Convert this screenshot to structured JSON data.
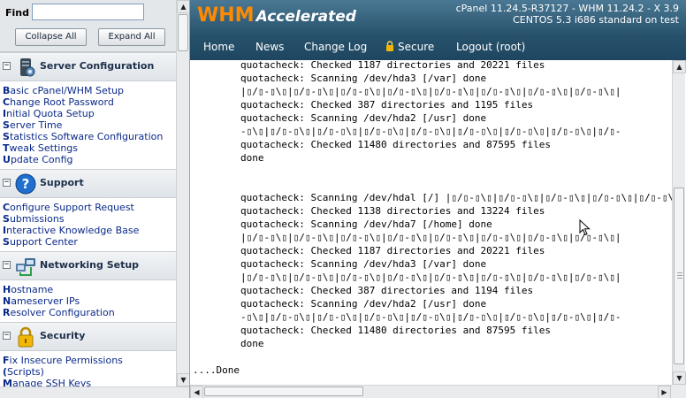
{
  "find": {
    "label": "Find",
    "value": "",
    "collapse_label": "Collapse All",
    "expand_label": "Expand All"
  },
  "sections": [
    {
      "title": "Server Configuration",
      "icon": "server-config-icon",
      "items": [
        {
          "first": "B",
          "rest": "asic cPanel/WHM Setup"
        },
        {
          "first": "C",
          "rest": "hange Root Password"
        },
        {
          "first": "I",
          "rest": "nitial Quota Setup"
        },
        {
          "first": "S",
          "rest": "erver Time"
        },
        {
          "first": "S",
          "rest": "tatistics Software Configuration"
        },
        {
          "first": "T",
          "rest": "weak Settings"
        },
        {
          "first": "U",
          "rest": "pdate Config"
        }
      ]
    },
    {
      "title": "Support",
      "icon": "support-icon",
      "items": [
        {
          "first": "C",
          "rest": "onfigure Support Request"
        },
        {
          "first": "S",
          "rest": "ubmissions"
        },
        {
          "first": "I",
          "rest": "nteractive Knowledge Base"
        },
        {
          "first": "S",
          "rest": "upport Center"
        }
      ]
    },
    {
      "title": "Networking Setup",
      "icon": "networking-icon",
      "items": [
        {
          "first": "H",
          "rest": "ostname"
        },
        {
          "first": "N",
          "rest": "ameserver IPs"
        },
        {
          "first": "R",
          "rest": "esolver Configuration"
        }
      ]
    },
    {
      "title": "Security",
      "icon": "padlock-icon",
      "items": [
        {
          "first": "F",
          "rest": "ix Insecure Permissions"
        },
        {
          "first": "(",
          "rest": "Scripts)"
        },
        {
          "first": "M",
          "rest": "anage SSH Keys"
        }
      ]
    }
  ],
  "header": {
    "logo_main": "WHM",
    "logo_sub": "Accelerated",
    "version_line1": "cPanel 11.24.5-R37127 - WHM 11.24.2 - X 3.9",
    "version_line2": "CENTOS 5.3 i686 standard on test"
  },
  "nav": {
    "home": "Home",
    "news": "News",
    "changelog": "Change Log",
    "secure": "Secure",
    "logout": "Logout (root)"
  },
  "console": {
    "lines": [
      {
        "text": "quotacheck: Checked 1187 directories and 20221 files"
      },
      {
        "text": "quotacheck: Scanning /dev/hda3 [/var] done"
      },
      {
        "text": "|▯/▯-▯\\▯|▯/▯-▯\\▯|▯/▯-▯\\▯|▯/▯-▯\\▯|▯/▯-▯\\▯|▯/▯-▯\\▯|▯/▯-▯\\▯|▯/▯-▯\\▯|"
      },
      {
        "text": "quotacheck: Checked 387 directories and 1195 files"
      },
      {
        "text": "quotacheck: Scanning /dev/hda2 [/usr] done"
      },
      {
        "text": "-▯\\▯|▯/▯-▯\\▯|▯/▯-▯\\▯|▯/▯-▯\\▯|▯/▯-▯\\▯|▯/▯-▯\\▯|▯/▯-▯\\▯|▯/▯-▯\\▯|▯/▯-"
      },
      {
        "text": "quotacheck: Checked 11480 directories and 87595 files"
      },
      {
        "text": "done"
      },
      {
        "text": ""
      },
      {
        "text": ""
      },
      {
        "text": "quotacheck: Scanning /dev/hdal [/] |▯/▯-▯\\▯|▯/▯-▯\\▯|▯/▯-▯\\▯|▯/▯-▯\\▯|▯/▯-▯\\▯|"
      },
      {
        "text": "quotacheck: Checked 1138 directories and 13224 files"
      },
      {
        "text": "quotacheck: Scanning /dev/hda7 [/home] done"
      },
      {
        "text": "|▯/▯-▯\\▯|▯/▯-▯\\▯|▯/▯-▯\\▯|▯/▯-▯\\▯|▯/▯-▯\\▯|▯/▯-▯\\▯|▯/▯-▯\\▯|▯/▯-▯\\▯|"
      },
      {
        "text": "quotacheck: Checked 1187 directories and 20221 files"
      },
      {
        "text": "quotacheck: Scanning /dev/hda3 [/var] done"
      },
      {
        "text": "|▯/▯-▯\\▯|▯/▯-▯\\▯|▯/▯-▯\\▯|▯/▯-▯\\▯|▯/▯-▯\\▯|▯/▯-▯\\▯|▯/▯-▯\\▯|▯/▯-▯\\▯|"
      },
      {
        "text": "quotacheck: Checked 387 directories and 1194 files"
      },
      {
        "text": "quotacheck: Scanning /dev/hda2 [/usr] done"
      },
      {
        "text": "-▯\\▯|▯/▯-▯\\▯|▯/▯-▯\\▯|▯/▯-▯\\▯|▯/▯-▯\\▯|▯/▯-▯\\▯|▯/▯-▯\\▯|▯/▯-▯\\▯|▯/▯-"
      },
      {
        "text": "quotacheck: Checked 11480 directories and 87595 files"
      },
      {
        "text": "done"
      },
      {
        "text": ""
      },
      {
        "text": "....Done",
        "flush": true
      }
    ]
  },
  "colors": {
    "header_bg": "#27516b",
    "logo_orange": "#ff8a00",
    "link_blue": "#0a2a8a"
  }
}
